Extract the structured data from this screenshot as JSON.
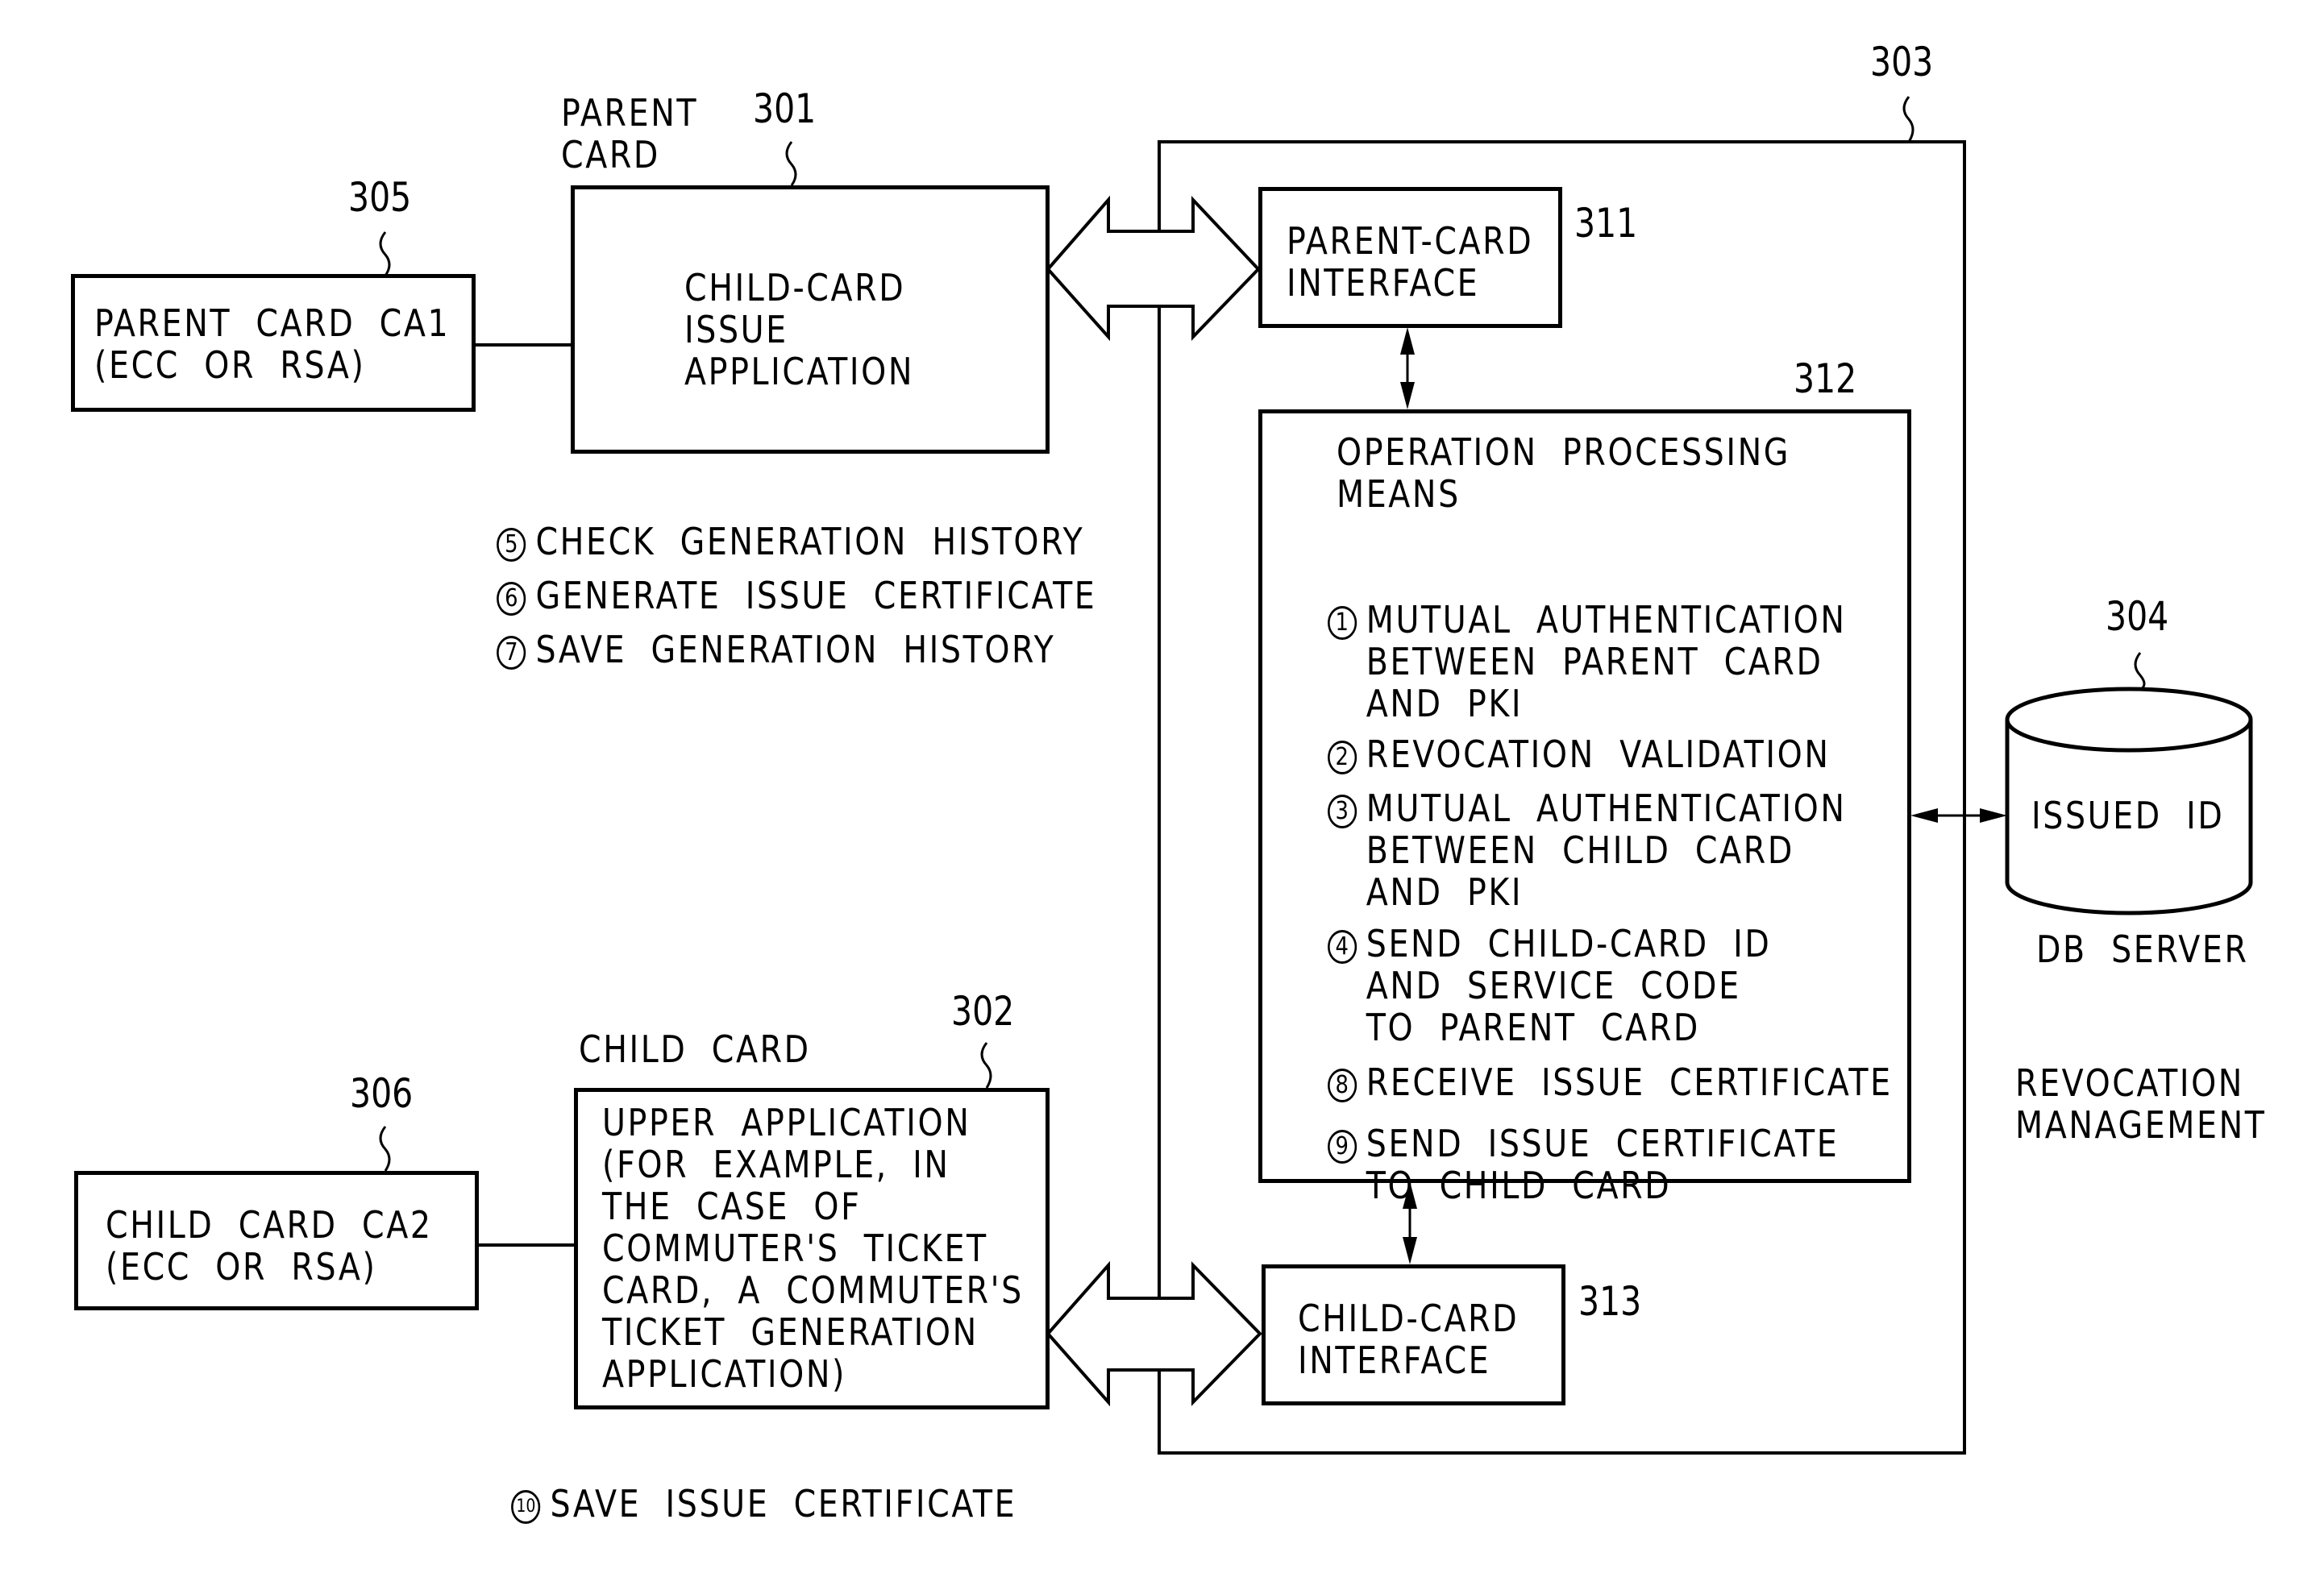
{
  "refs": {
    "r301": "301",
    "r302": "302",
    "r303": "303",
    "r304": "304",
    "r305": "305",
    "r306": "306",
    "r311": "311",
    "r312": "312",
    "r313": "313"
  },
  "parent_card": {
    "label": "PARENT\nCARD",
    "app": "CHILD-CARD\nISSUE\nAPPLICATION",
    "ca_box": "PARENT  CARD  CA1\n(ECC  OR  RSA)",
    "steps": [
      {
        "num": "5",
        "text": "CHECK  GENERATION  HISTORY"
      },
      {
        "num": "6",
        "text": "GENERATE  ISSUE  CERTIFICATE"
      },
      {
        "num": "7",
        "text": "SAVE  GENERATION  HISTORY"
      }
    ]
  },
  "child_card": {
    "label": "CHILD  CARD",
    "app": "UPPER  APPLICATION\n(FOR  EXAMPLE,  IN\nTHE  CASE  OF\nCOMMUTER'S  TICKET\nCARD,  A  COMMUTER'S\nTICKET  GENERATION\nAPPLICATION)",
    "ca_box": "CHILD  CARD  CA2\n(ECC  OR  RSA)",
    "steps": [
      {
        "num": "10",
        "text": "SAVE  ISSUE  CERTIFICATE"
      }
    ]
  },
  "server": {
    "parent_interface": "PARENT-CARD\nINTERFACE",
    "child_interface": "CHILD-CARD\nINTERFACE",
    "processing_title": "OPERATION  PROCESSING\nMEANS",
    "steps": [
      {
        "num": "1",
        "text": "MUTUAL  AUTHENTICATION\nBETWEEN  PARENT  CARD\nAND  PKI"
      },
      {
        "num": "2",
        "text": "REVOCATION  VALIDATION"
      },
      {
        "num": "3",
        "text": "MUTUAL  AUTHENTICATION\nBETWEEN  CHILD  CARD\nAND  PKI"
      },
      {
        "num": "4",
        "text": "SEND  CHILD-CARD  ID\nAND  SERVICE  CODE\nTO  PARENT  CARD"
      },
      {
        "num": "8",
        "text": "RECEIVE  ISSUE  CERTIFICATE"
      },
      {
        "num": "9",
        "text": "SEND  ISSUE  CERTIFICATE\nTO  CHILD  CARD"
      }
    ],
    "caption": "REVOCATION\nMANAGEMENT"
  },
  "db": {
    "content": "ISSUED  ID",
    "label": "DB  SERVER"
  }
}
